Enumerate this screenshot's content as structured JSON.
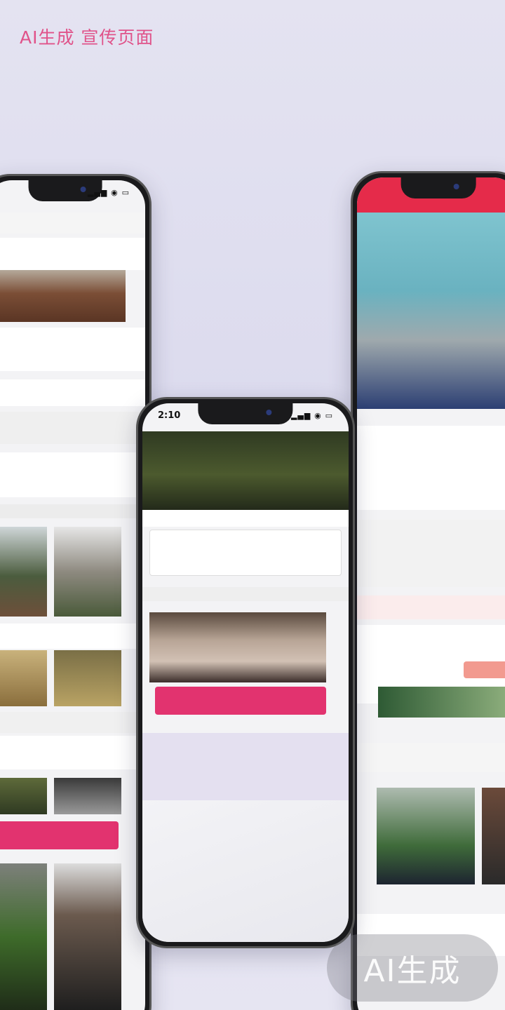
{
  "headline": {
    "line1": "AI生成 宣传页面",
    "line2": "",
    "line3": ""
  },
  "center_mark": "",
  "phones": {
    "center": {
      "time": "2:10"
    },
    "right": {
      "time": ""
    }
  },
  "watermark": "AI生成",
  "colors": {
    "accent_pink": "#e2336f",
    "headline_pink": "#e0538a",
    "background": "#e4e3f1",
    "right_phone_top": "#e52b4a"
  }
}
